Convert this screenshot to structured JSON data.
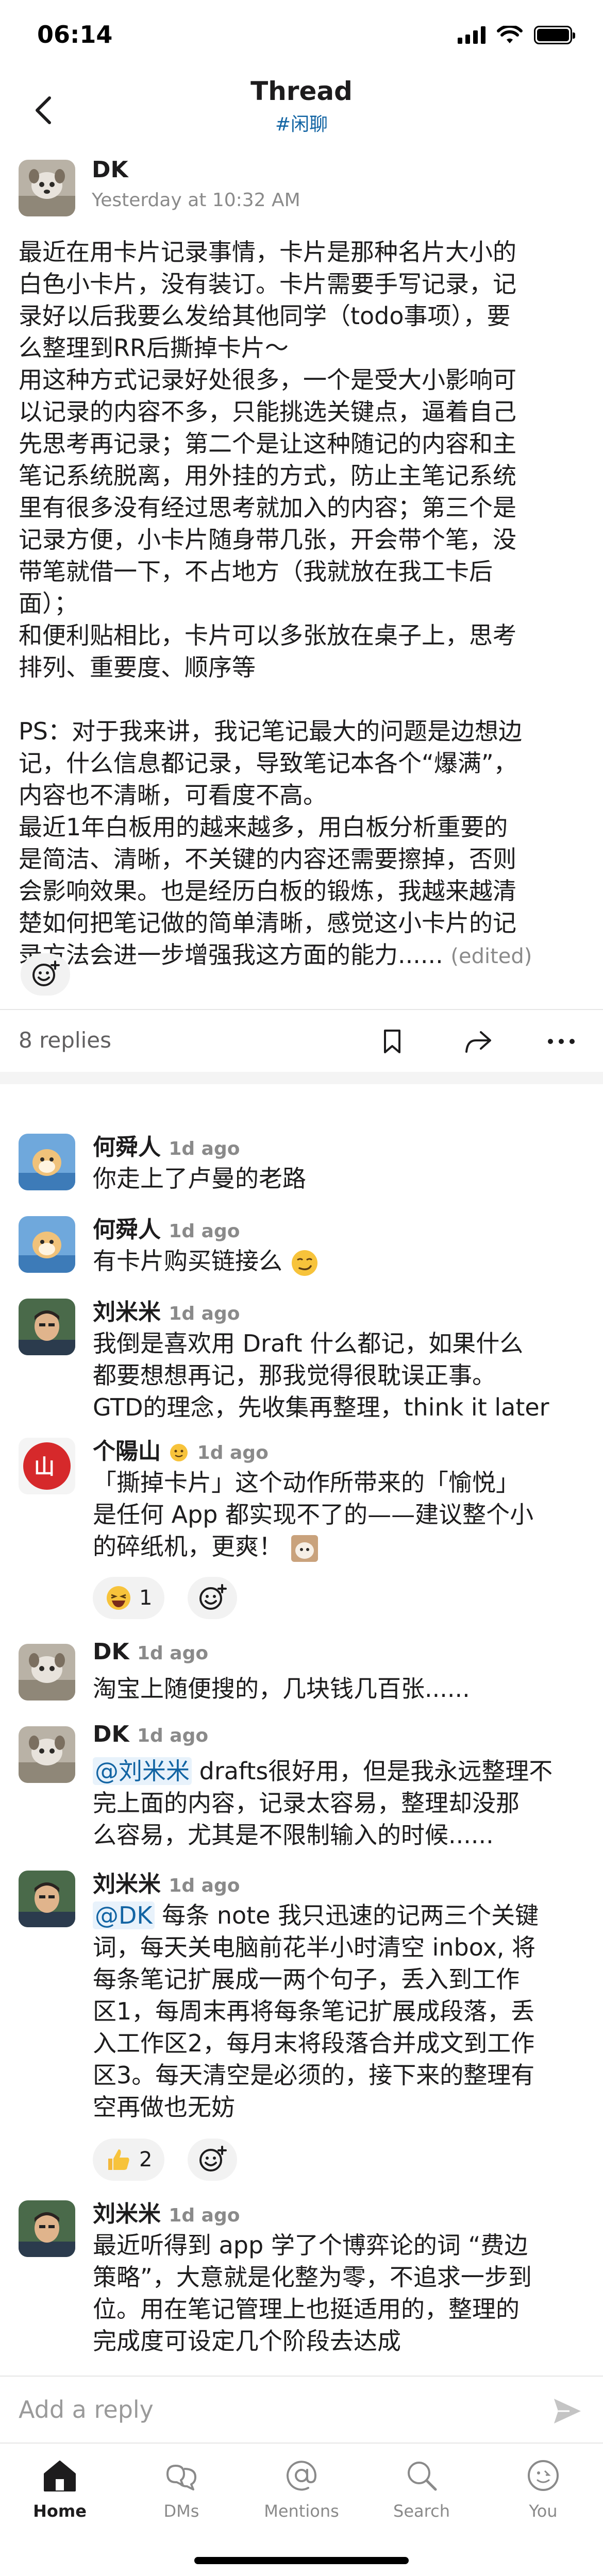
{
  "status": {
    "time": "06:14"
  },
  "header": {
    "title": "Thread",
    "channel": "#闲聊"
  },
  "parent": {
    "author": "DK",
    "timestamp": "Yesterday at 10:32 AM",
    "lines": [
      "最近在用卡片记录事情，卡片是那种名片大小的",
      "白色小卡片，没有装订。卡片需要手写记录，记",
      "录好以后我要么发给其他同学（todo事项），要",
      "么整理到RR后撕掉卡片～",
      "用这种方式记录好处很多，一个是受大小影响可",
      "以记录的内容不多，只能挑选关键点，逼着自己",
      "先思考再记录；第二个是让这种随记的内容和主",
      "笔记系统脱离，用外挂的方式，防止主笔记系统",
      "里有很多没有经过思考就加入的内容；第三个是",
      "记录方便，小卡片随身带几张，开会带个笔，没",
      "带笔就借一下，不占地方（我就放在我工卡后",
      "面）；",
      "和便利贴相比，卡片可以多张放在桌子上，思考",
      "排列、重要度、顺序等",
      "",
      "PS：对于我来讲，我记笔记最大的问题是边想边",
      "记，什么信息都记录，导致笔记本各个“爆满”，",
      "内容也不清晰，可看度不高。",
      "最近1年白板用的越来越多，用白板分析重要的",
      "是简洁、清晰，不关键的内容还需要擦掉，否则",
      "会影响效果。也是经历白板的锻炼，我越来越清",
      "楚如何把笔记做的简单清晰，感觉这小卡片的记",
      "录方法会进一步增强我这方面的能力......"
    ],
    "edited": "(edited)"
  },
  "thread_bar": {
    "replies": "8 replies"
  },
  "replies": [
    {
      "author": "何舜人",
      "time": "1d ago",
      "lines": [
        "你走上了卢曼的老路"
      ]
    },
    {
      "author": "何舜人",
      "time": "1d ago",
      "lines": [
        "有卡片购买链接么"
      ]
    },
    {
      "author": "刘米米",
      "time": "1d ago",
      "lines": [
        "我倒是喜欢用 Draft 什么都记，如果什么",
        "都要想想再记，那我觉得很耽误正事。",
        "GTD的理念，先收集再整理，think it later"
      ]
    },
    {
      "author": "个陽山",
      "time": "1d ago",
      "lines": [
        "「撕掉卡片」这个动作所带来的「愉悦」",
        "是任何 App 都实现不了的——建议整个小",
        "的碎纸机，更爽！"
      ],
      "reaction_count": "1"
    },
    {
      "author": "DK",
      "time": "1d ago",
      "lines": [
        "淘宝上随便搜的，几块钱几百张......"
      ]
    },
    {
      "author": "DK",
      "time": "1d ago",
      "mention": "@刘米米",
      "lines": [
        " drafts很好用，但是我永远整理不",
        "完上面的内容，记录太容易，整理却没那",
        "么容易，尤其是不限制输入的时候......"
      ]
    },
    {
      "author": "刘米米",
      "time": "1d ago",
      "mention": "@DK",
      "lines": [
        " 每条 note 我只迅速的记两三个关键",
        "词，每天关电脑前花半小时清空 inbox, 将",
        "每条笔记扩展成一两个句子，丢入到工作",
        "区1，每周末再将每条笔记扩展成段落，丢",
        "入工作区2，每月末将段落合并成文到工作",
        "区3。每天清空是必须的，接下来的整理有",
        "空再做也无妨"
      ],
      "reaction_count": "2"
    },
    {
      "author": "刘米米",
      "time": "1d ago",
      "lines": [
        "最近听得到 app 学了个博弈论的词 “费边",
        "策略”，大意就是化整为零，不追求一步到",
        "位。用在笔记管理上也挺适用的，整理的",
        "完成度可设定几个阶段去达成"
      ]
    }
  ],
  "composer": {
    "placeholder": "Add a reply"
  },
  "tabs": [
    {
      "label": "Home",
      "icon": "home-icon"
    },
    {
      "label": "DMs",
      "icon": "dm-icon"
    },
    {
      "label": "Mentions",
      "icon": "at-icon"
    },
    {
      "label": "Search",
      "icon": "search-icon"
    },
    {
      "label": "You",
      "icon": "profile-icon"
    }
  ]
}
